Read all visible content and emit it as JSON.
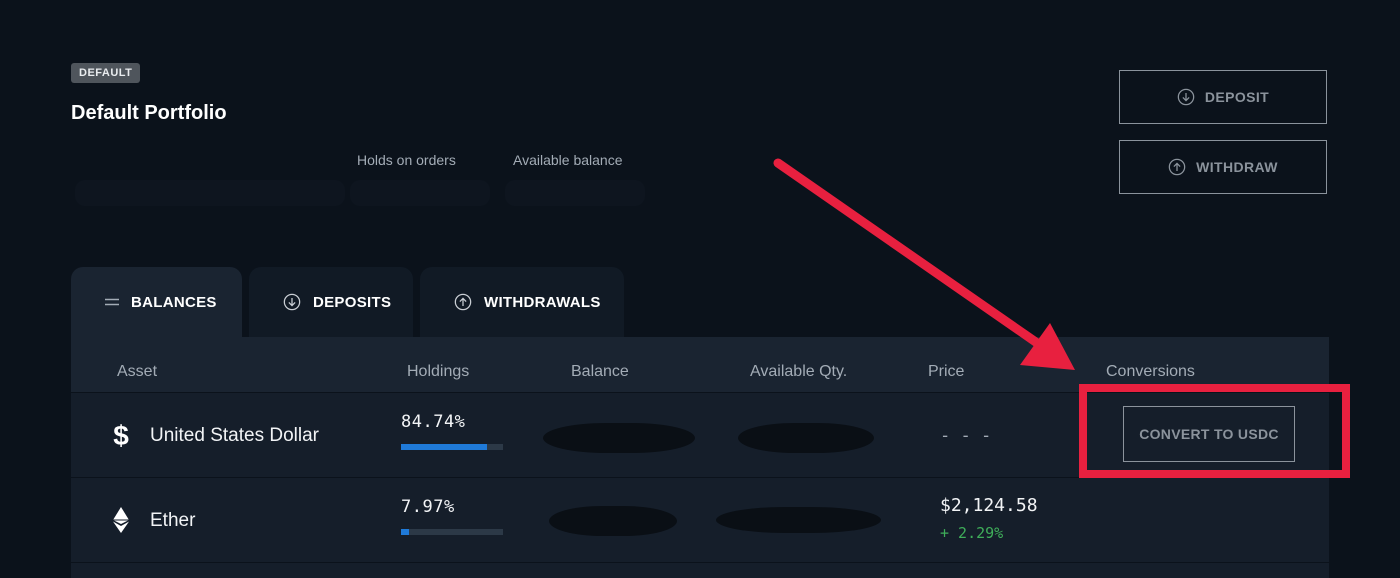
{
  "portfolio": {
    "badge": "DEFAULT",
    "title": "Default Portfolio",
    "summary_labels": [
      "Holds on orders",
      "Available balance"
    ]
  },
  "actions": {
    "deposit_label": "DEPOSIT",
    "withdraw_label": "WITHDRAW"
  },
  "tabs": [
    {
      "label": "BALANCES",
      "icon": "menu-icon",
      "active": true
    },
    {
      "label": "DEPOSITS",
      "icon": "arrow-down-circle-icon",
      "active": false
    },
    {
      "label": "WITHDRAWALS",
      "icon": "arrow-up-circle-icon",
      "active": false
    }
  ],
  "table": {
    "columns": [
      "Asset",
      "Holdings",
      "Balance",
      "Available Qty.",
      "Price",
      "Conversions"
    ],
    "rows": [
      {
        "asset": "United States Dollar",
        "icon": "dollar-icon",
        "holdings_pct": "84.74%",
        "holdings_fraction": 0.8474,
        "price": "- - -",
        "conversion_label": "CONVERT TO USDC"
      },
      {
        "asset": "Ether",
        "icon": "ethereum-icon",
        "holdings_pct": "7.97%",
        "holdings_fraction": 0.0797,
        "price": "$2,124.58",
        "price_change": "+ 2.29%"
      }
    ]
  },
  "colors": {
    "background": "#0b121b",
    "accent": "#1f7ad8",
    "positive": "#3fae5a",
    "annotation": "#e8203f"
  }
}
